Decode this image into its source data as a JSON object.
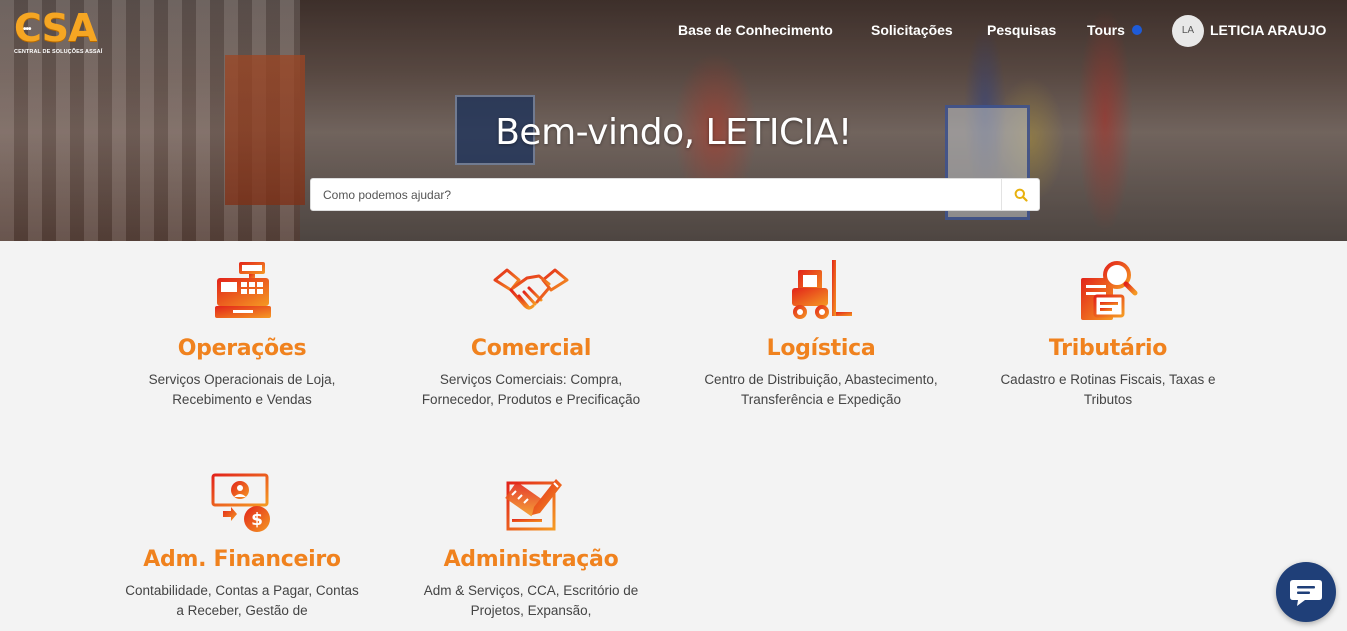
{
  "brand": {
    "logo_text": "CSA",
    "logo_subtitle": "CENTRAL DE SOLUÇÕES ASSAÍ"
  },
  "nav": {
    "items": [
      {
        "label": "Base de Conhecimento"
      },
      {
        "label": "Solicitações"
      },
      {
        "label": "Pesquisas"
      },
      {
        "label": "Tours"
      }
    ],
    "user": {
      "initials": "LA",
      "name": "LETICIA ARAUJO"
    }
  },
  "hero": {
    "welcome": "Bem-vindo, LETICIA!",
    "search_placeholder": "Como podemos ajudar?"
  },
  "categories": [
    {
      "title": "Operações",
      "description": "Serviços Operacionais de Loja, Recebimento e Vendas",
      "icon": "cash-register-icon"
    },
    {
      "title": "Comercial",
      "description": "Serviços Comerciais: Compra, Fornecedor, Produtos e Precificação",
      "icon": "handshake-icon"
    },
    {
      "title": "Logística",
      "description": "Centro de Distribuição, Abastecimento, Transferência e Expedição",
      "icon": "forklift-icon"
    },
    {
      "title": "Tributário",
      "description": "Cadastro e Rotinas Fiscais, Taxas e Tributos",
      "icon": "tax-document-icon"
    },
    {
      "title": "Adm. Financeiro",
      "description": "Contabilidade, Contas a Pagar, Contas a Receber, Gestão de",
      "icon": "money-transfer-icon"
    },
    {
      "title": "Administração",
      "description": "Adm & Serviços, CCA, Escritório de Projetos, Expansão,",
      "icon": "clipboard-edit-icon"
    }
  ],
  "colors": {
    "accent": "#f0821e",
    "icon_red": "#e2231a",
    "chat": "#1f3f78"
  }
}
